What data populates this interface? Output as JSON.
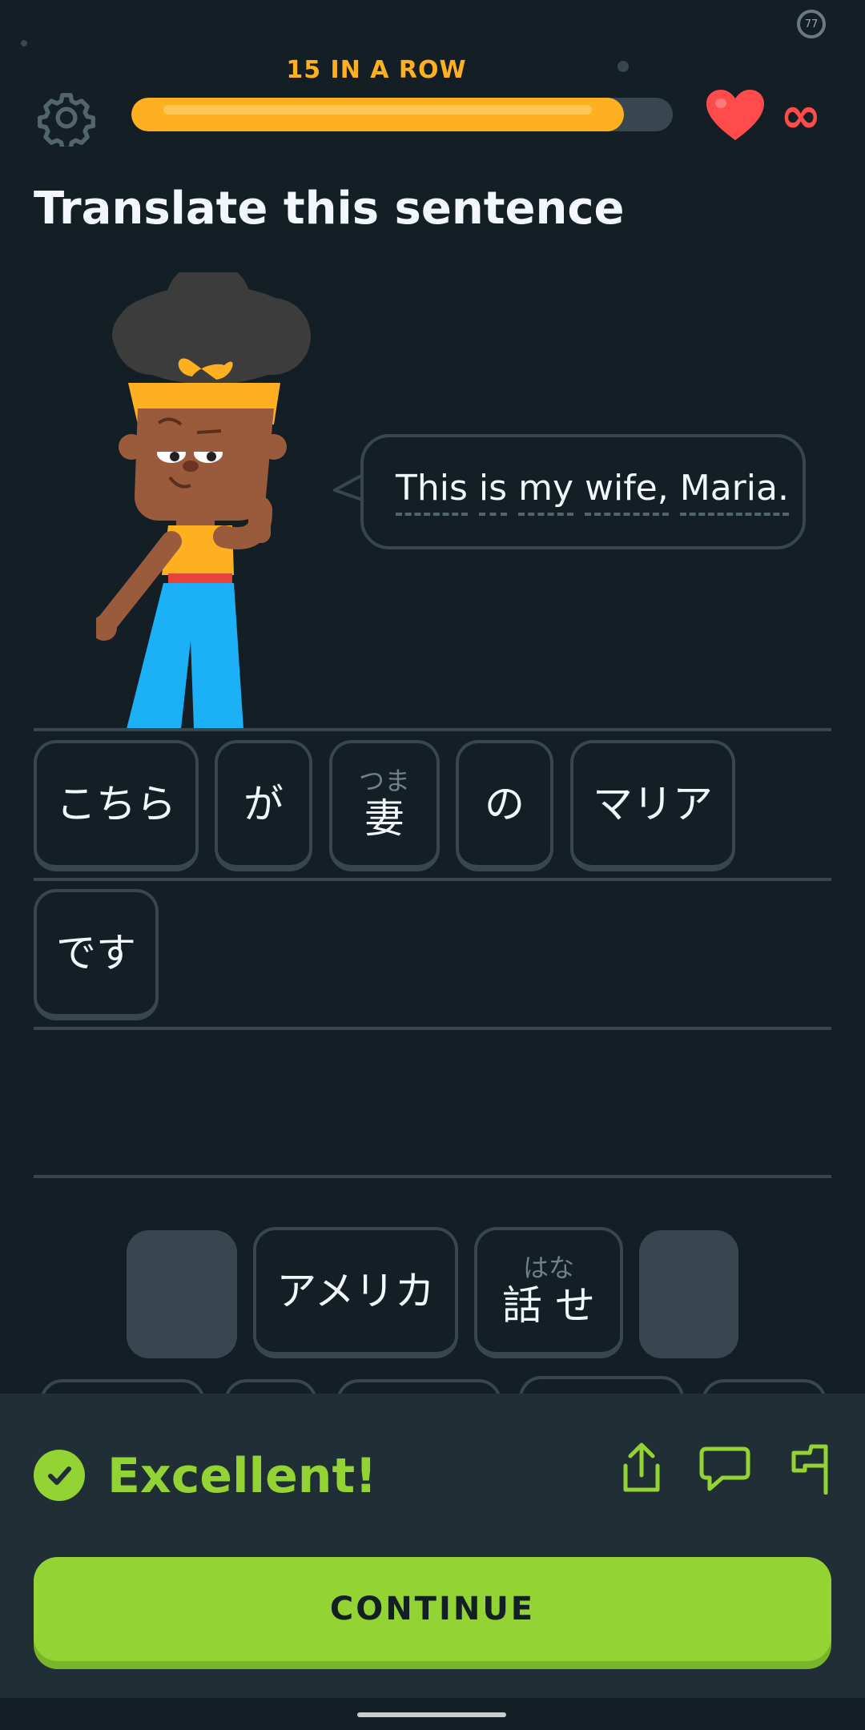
{
  "status": {
    "ring_value": "77"
  },
  "header": {
    "streak_label": "15 IN A ROW",
    "progress_fraction": 0.91,
    "hearts_value": "∞",
    "icons": {
      "settings": "gear-icon",
      "heart": "heart-icon"
    }
  },
  "prompt": {
    "title": "Translate this sentence",
    "sentence_words": [
      "This",
      "is",
      "my",
      "wife,",
      "Maria."
    ]
  },
  "answer_tiles": [
    {
      "ruby": "",
      "text": "こちら"
    },
    {
      "ruby": "",
      "text": "が"
    },
    {
      "ruby": "つま",
      "text": "妻"
    },
    {
      "ruby": "",
      "text": "の"
    },
    {
      "ruby": "",
      "text": "マリア"
    },
    {
      "ruby": "",
      "text": "です"
    }
  ],
  "word_bank": [
    {
      "ruby": "",
      "text": ""
    },
    {
      "ruby": "",
      "text": "アメリカ"
    },
    {
      "ruby": "はな",
      "text": "話 せ"
    },
    {
      "ruby": "",
      "text": ""
    }
  ],
  "feedback": {
    "title": "Excellent!",
    "icons": [
      "share-icon",
      "comment-icon",
      "flag-icon"
    ],
    "continue_label": "CONTINUE"
  },
  "colors": {
    "background": "#131f24",
    "accent_orange": "#ffb020",
    "success_green": "#93d333",
    "heart_red": "#ff4b4b",
    "tile_border": "#37464f"
  }
}
